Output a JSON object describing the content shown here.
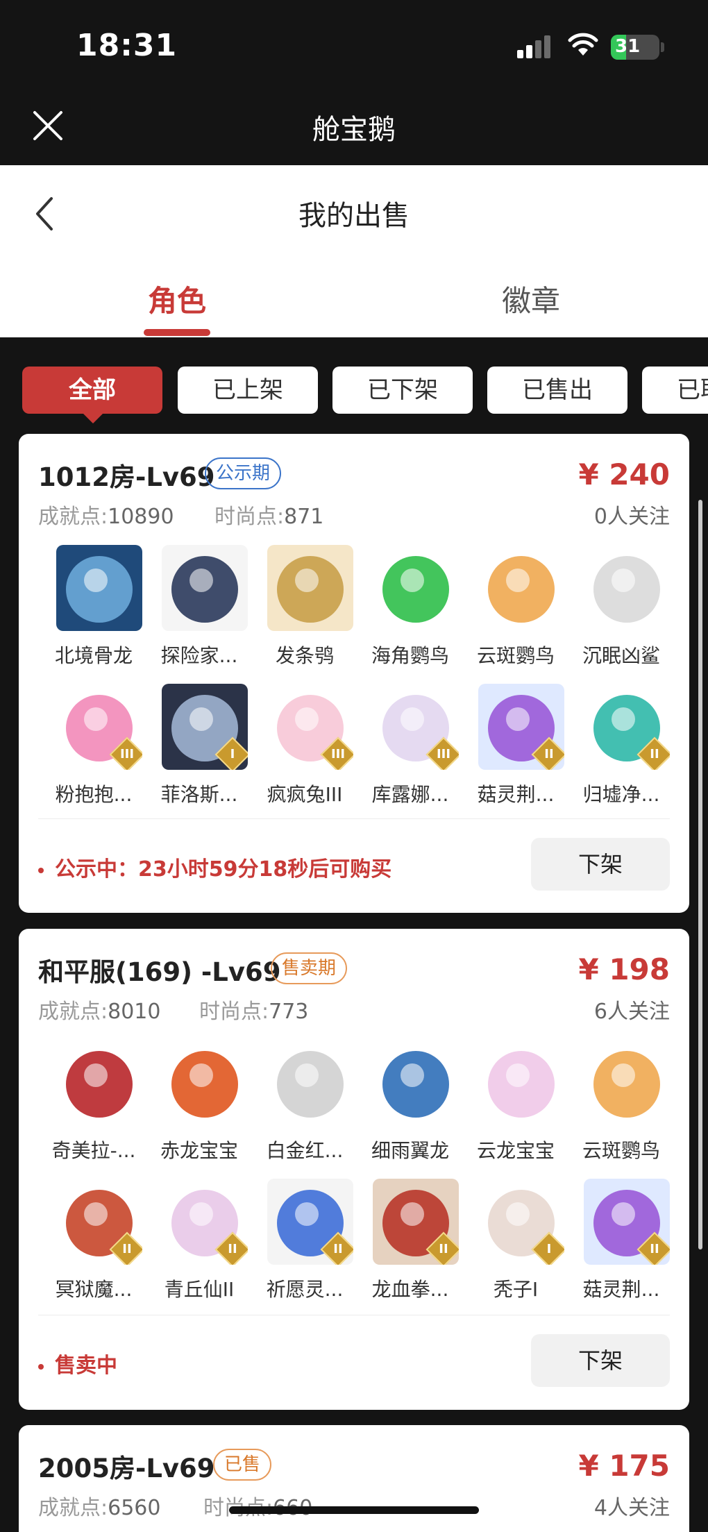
{
  "status_bar": {
    "time": "18:31",
    "battery": "31",
    "battery_level": 0.31
  },
  "app": {
    "title": "舱宝鹅"
  },
  "header": {
    "title": "我的出售"
  },
  "tabs": [
    {
      "label": "角色",
      "active": true
    },
    {
      "label": "徽章",
      "active": false
    }
  ],
  "filters": [
    {
      "label": "全部",
      "active": true
    },
    {
      "label": "已上架"
    },
    {
      "label": "已下架"
    },
    {
      "label": "已售出"
    },
    {
      "label": "已取消"
    }
  ],
  "listings": [
    {
      "title": "1012房-Lv69",
      "tag": "公示期",
      "price": "¥ 240",
      "followers": "0人关注",
      "achievement_label": "成就点:",
      "achievement_value": "10890",
      "fashion_label": "时尚点:",
      "fashion_value": "871",
      "items": [
        {
          "name": "北境骨龙",
          "tier": "",
          "colors": [
            "#1f4a7a",
            "#6aa8d8"
          ]
        },
        {
          "name": "探险家...",
          "tier": "",
          "colors": [
            "#f5f5f5",
            "#2b3a5c"
          ]
        },
        {
          "name": "发条鸮",
          "tier": "",
          "colors": [
            "#f5e6c8",
            "#c9a04a"
          ]
        },
        {
          "name": "海角鹦鸟",
          "tier": "",
          "colors": [
            "#ffffff",
            "#2fbf4a"
          ]
        },
        {
          "name": "云斑鹦鸟",
          "tier": "",
          "colors": [
            "#ffffff",
            "#f0a850"
          ]
        },
        {
          "name": "沉眠凶鲨",
          "tier": "",
          "colors": [
            "#ffffff",
            "#d9d9d9"
          ]
        },
        {
          "name": "粉抱抱...",
          "tier": "III",
          "colors": [
            "#ffffff",
            "#f28ab8"
          ]
        },
        {
          "name": "菲洛斯...",
          "tier": "I",
          "colors": [
            "#2b3348",
            "#9fb3d0"
          ]
        },
        {
          "name": "疯疯兔III",
          "tier": "III",
          "colors": [
            "#ffffff",
            "#f7c6d6"
          ]
        },
        {
          "name": "库露娜...",
          "tier": "III",
          "colors": [
            "#ffffff",
            "#e2d6f0"
          ]
        },
        {
          "name": "菇灵荆...",
          "tier": "II",
          "colors": [
            "#dfe9ff",
            "#9a5ad8"
          ]
        },
        {
          "name": "归墟净...",
          "tier": "II",
          "colors": [
            "#ffffff",
            "#2fb8a8"
          ]
        }
      ],
      "footer_status": "公示中：23小时59分18秒后可购买",
      "action": "下架"
    },
    {
      "title": "和平服(169) -Lv69",
      "tag": "售卖期",
      "price": "¥ 198",
      "followers": "6人关注",
      "achievement_label": "成就点:",
      "achievement_value": "8010",
      "fashion_label": "时尚点:",
      "fashion_value": "773",
      "items": [
        {
          "name": "奇美拉-...",
          "tier": "",
          "colors": [
            "#ffffff",
            "#b8262a"
          ]
        },
        {
          "name": "赤龙宝宝",
          "tier": "",
          "colors": [
            "#ffffff",
            "#e0571f"
          ]
        },
        {
          "name": "白金红...",
          "tier": "",
          "colors": [
            "#ffffff",
            "#d0d0d0"
          ]
        },
        {
          "name": "细雨翼龙",
          "tier": "",
          "colors": [
            "#ffffff",
            "#2f6fb8"
          ]
        },
        {
          "name": "云龙宝宝",
          "tier": "",
          "colors": [
            "#ffffff",
            "#f0c8e8"
          ]
        },
        {
          "name": "云斑鹦鸟",
          "tier": "",
          "colors": [
            "#ffffff",
            "#f0a850"
          ]
        },
        {
          "name": "冥狱魔...",
          "tier": "II",
          "colors": [
            "#ffffff",
            "#c7462a"
          ]
        },
        {
          "name": "青丘仙II",
          "tier": "II",
          "colors": [
            "#ffffff",
            "#e8c8e8"
          ]
        },
        {
          "name": "祈愿灵...",
          "tier": "II",
          "colors": [
            "#f4f4f4",
            "#3f6fd8"
          ]
        },
        {
          "name": "龙血拳...",
          "tier": "II",
          "colors": [
            "#e6d2c0",
            "#b8362a"
          ]
        },
        {
          "name": "秃子I",
          "tier": "I",
          "colors": [
            "#ffffff",
            "#e8d8d0"
          ]
        },
        {
          "name": "菇灵荆...",
          "tier": "II",
          "colors": [
            "#dfe9ff",
            "#9a5ad8"
          ]
        }
      ],
      "footer_status": "售卖中",
      "action": "下架"
    },
    {
      "title": "2005房-Lv69",
      "tag": "已售",
      "price": "¥ 175",
      "followers": "4人关注",
      "achievement_label": "成就点:",
      "achievement_value": "6560",
      "fashion_label": "时尚点:",
      "fashion_value": "660"
    }
  ],
  "colors": {
    "accent": "#c83a37",
    "background": "#141414",
    "tag_blue": "#3b74c9",
    "tag_orange": "#d9792b"
  }
}
